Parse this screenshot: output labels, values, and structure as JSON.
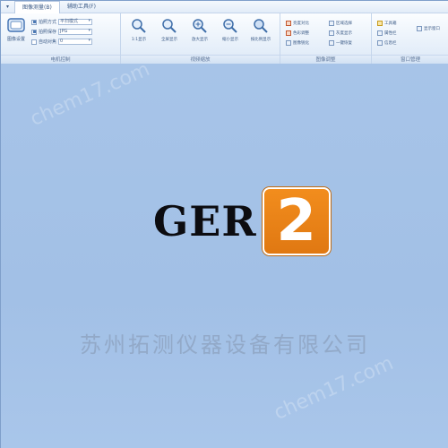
{
  "tabs": [
    {
      "label": "▾"
    },
    {
      "label": "图像测量(B)"
    },
    {
      "label": "辅助工具(F)"
    }
  ],
  "ribbon": {
    "groups": [
      {
        "label": "电机控制"
      },
      {
        "label": "视频缩放"
      },
      {
        "label": "图像调整"
      },
      {
        "label": "窗口管理"
      }
    ],
    "image_settings_button": "图像设置",
    "checks": [
      {
        "label": "拍照方式",
        "value": "平扫模式",
        "checked": true
      },
      {
        "label": "拍照保存",
        "value": "JPG",
        "checked": true
      },
      {
        "label": "自动对焦",
        "value": "0",
        "checked": false
      }
    ],
    "zoom_buttons": [
      {
        "label": "1:1显示",
        "icon": "magnifier-icon"
      },
      {
        "label": "全屏显示",
        "icon": "magnifier-icon"
      },
      {
        "label": "放大显示",
        "icon": "magnifier-icon"
      },
      {
        "label": "缩小显示",
        "icon": "magnifier-icon"
      },
      {
        "label": "按比例显示",
        "icon": "magnifier-icon"
      }
    ],
    "adjust_buttons": [
      {
        "label": "亮度对比",
        "icon": "contrast-icon"
      },
      {
        "label": "色彩调整",
        "icon": "color-icon"
      },
      {
        "label": "图像锐化",
        "icon": "sharpen-icon"
      },
      {
        "label": "区域选择",
        "icon": "region-icon"
      },
      {
        "label": "灰度显示",
        "icon": "gray-icon"
      },
      {
        "label": "一键恢复",
        "icon": "restore-icon"
      }
    ],
    "window_buttons": [
      {
        "label": "工具箱",
        "icon": "toolbox-icon"
      },
      {
        "label": "属性栏",
        "icon": "property-icon"
      },
      {
        "label": "信息栏",
        "icon": "info-icon"
      },
      {
        "label": "显示窗口",
        "icon": "window-icon"
      }
    ]
  },
  "workspace": {
    "logo_text": "GER",
    "logo_number": "2",
    "company_name": "苏州拓测仪器设备有限公司",
    "watermark_top": "chem17.com",
    "watermark_bottom": "chem17.com"
  },
  "colors": {
    "workspace_bg": "#a7c4e8",
    "badge_orange": "#e88317",
    "logo_text": "#0c0c10"
  }
}
